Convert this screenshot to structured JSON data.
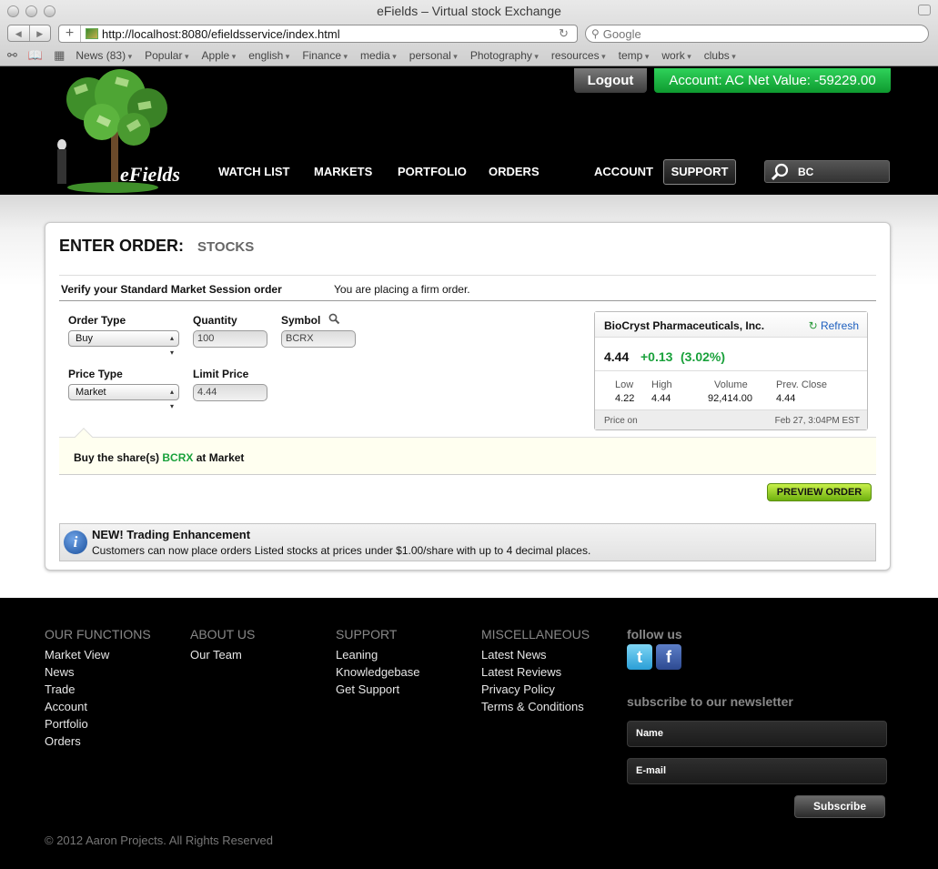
{
  "browser": {
    "window_title": "eFields – Virtual stock Exchange",
    "nav_back": "◀",
    "nav_forward": "▶",
    "new_tab": "+",
    "url": "http://localhost:8080/efieldsservice/index.html",
    "reload_icon": "↻",
    "search_placeholder": "Google",
    "bookmarks": [
      "News (83)",
      "Popular",
      "Apple",
      "english",
      "Finance",
      "media",
      "personal",
      "Photography",
      "resources",
      "temp",
      "work",
      "clubs"
    ]
  },
  "header": {
    "logo_text": "eFields",
    "logout": "Logout",
    "account": "Account: AC Net Value: -59229.00",
    "nav": [
      "WATCH LIST",
      "MARKETS",
      "PORTFOLIO",
      "ORDERS"
    ],
    "account_link": "ACCOUNT",
    "support": "SUPPORT",
    "search_value": "BC"
  },
  "order": {
    "title": "ENTER ORDER:",
    "subtitle": "STOCKS",
    "verify_label": "Verify your Standard Market Session order",
    "verify_note": "You are placing a firm order.",
    "order_type_label": "Order Type",
    "order_type_value": "Buy",
    "quantity_label": "Quantity",
    "quantity_value": "100",
    "symbol_label": "Symbol",
    "symbol_value": "BCRX",
    "price_type_label": "Price Type",
    "price_type_value": "Market",
    "limit_price_label": "Limit Price",
    "limit_price_value": "4.44",
    "summary_prefix": "Buy the share(s)",
    "summary_symbol": "BCRX",
    "summary_suffix": "at Market",
    "preview_button": "PREVIEW ORDER"
  },
  "quote": {
    "name": "BioCryst Pharmaceuticals, Inc.",
    "refresh": "Refresh",
    "price": "4.44",
    "change": "+0.13",
    "change_pct": "(3.02%)",
    "low_label": "Low",
    "low": "4.22",
    "high_label": "High",
    "high": "4.44",
    "volume_label": "Volume",
    "volume": "92,414.00",
    "prev_close_label": "Prev. Close",
    "prev_close": "4.44",
    "price_on_label": "Price on",
    "timestamp": "Feb 27, 3:04PM EST"
  },
  "notice": {
    "icon": "i",
    "title": "NEW! Trading Enhancement",
    "body": "Customers can now place orders Listed stocks at prices under $1.00/share with up to 4 decimal places."
  },
  "footer": {
    "columns": [
      {
        "heading": "OUR FUNCTIONS",
        "links": [
          "Market View",
          "News",
          "Trade",
          "Account",
          "Portfolio",
          "Orders"
        ]
      },
      {
        "heading": "ABOUT US",
        "links": [
          "Our Team"
        ]
      },
      {
        "heading": "SUPPORT",
        "links": [
          "Leaning",
          "Knowledgebase",
          "Get Support"
        ]
      },
      {
        "heading": "MISCELLANEOUS",
        "links": [
          "Latest News",
          "Latest Reviews",
          "Privacy Policy",
          "Terms & Conditions"
        ]
      }
    ],
    "follow_us": "follow us",
    "twitter_glyph": "t",
    "facebook_glyph": "f",
    "newsletter_title": "subscribe to our newsletter",
    "name_placeholder": "Name",
    "email_placeholder": "E-mail",
    "subscribe": "Subscribe",
    "copyright": "© 2012 Aaron Projects. All Rights Reserved"
  },
  "colors": {
    "accent_green": "#19a13b",
    "account_badge": "#16b53d",
    "preview_button": "#8ccc1e",
    "link_blue": "#1d5fbf"
  }
}
